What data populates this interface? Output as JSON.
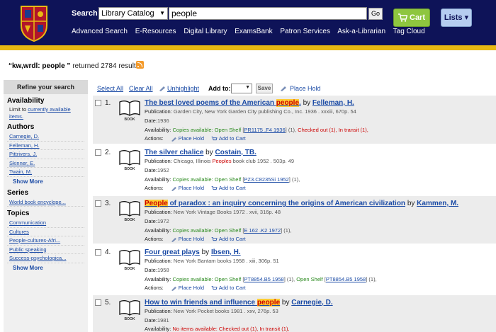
{
  "header": {
    "search_label": "Search",
    "scope_value": "Library Catalog",
    "query_value": "people",
    "go_label": "Go",
    "cart_label": "Cart",
    "lists_label": "Lists ▾",
    "nav": [
      "Advanced Search",
      "E-Resources",
      "Digital Library",
      "ExamsBank",
      "Patron Services",
      "Ask-a-Librarian",
      "Tag Cloud"
    ],
    "colors": {
      "header_bg": "#0e1358",
      "gold_bar": "#e8b913",
      "cart_green": "#8ec63f",
      "lists_blue": "#b6cdf0"
    }
  },
  "results_summary": {
    "query": "“kw,wrdl: people ”",
    "text": "returned 2784 results."
  },
  "sidebar": {
    "heading": "Refine your search",
    "availability": {
      "title": "Availability",
      "text_prefix": "Limit to",
      "link": "currently available items."
    },
    "authors": {
      "title": "Authors",
      "items": [
        "Carnegie, D.",
        "Felleman, H.",
        "Pittrivers, J.",
        "Skinner, E.",
        "Twain, M."
      ],
      "show_more": "Show More"
    },
    "series": {
      "title": "Series",
      "items": [
        "World book encyclope..."
      ]
    },
    "topics": {
      "title": "Topics",
      "items": [
        "Communication",
        "Cultures",
        "People-cultures-Afri...",
        "Public speaking",
        "Success-psychologica..."
      ],
      "show_more": "Show More"
    }
  },
  "toolbar": {
    "select_all": "Select All",
    "clear_all": "Clear All",
    "unhighlight": "Unhighlight",
    "add_to": "Add to:",
    "save": "Save",
    "place_hold": "Place Hold"
  },
  "labels": {
    "publication": "Publication:",
    "date": "Date:",
    "availability": "Availability:",
    "actions": "Actions:",
    "place_hold": "Place Hold",
    "add_to_cart": "Add to Cart",
    "book": "BOOK"
  },
  "results": [
    {
      "num": "1.",
      "title_pre": "The best loved poems of the American ",
      "title_hl": "people",
      "title_post": ".",
      "by": "by",
      "author": "Felleman, H.",
      "pub_pre": "Garden City, New York Garden City publishing Co., Inc. 1936 . xxxiii, 670p. 54",
      "date": "1936",
      "avail_label": "Copies available:",
      "avail_shelf": "Open Shelf",
      "call": "PR1175 .F4 1936",
      "avail_rest": " (1), ",
      "avail_red": "Checked out (1), In transit (1),"
    },
    {
      "num": "2.",
      "title": "The silver chalice",
      "by": "by",
      "author": "Costain, TB.",
      "pub_pre": "Chicago, Illinois ",
      "pub_hl": "Peoples",
      "pub_post": " book club 1952 . 503p. 49",
      "date": "1952",
      "avail_label": "Copies available:",
      "avail_shelf": "Open Shelf",
      "call": "PZ3.C8235Si 1952",
      "avail_rest": " (1),"
    },
    {
      "num": "3.",
      "title_hl": "People",
      "title_post": " of paradox : an inquiry concerning the origins of American civilization",
      "by": "by",
      "author": "Kammen, M.",
      "pub_pre": "New York Vintage Books 1972 . xvii, 316p. 48",
      "date": "1972",
      "avail_label": "Copies available:",
      "avail_shelf": "Open Shelf",
      "call": "E 162 .K2 1972",
      "avail_rest": " (1),"
    },
    {
      "num": "4.",
      "title": "Four great plays",
      "by": "by",
      "author": "Ibsen, H.",
      "pub_pre": "New York Bantam books 1958 . xiii, 306p. 51",
      "date": "1958",
      "avail_label": "Copies available:",
      "avail_shelf": "Open Shelf",
      "call": "PT8854.B5 1958",
      "avail_rest": " (1), ",
      "avail_shelf2": "Open Shelf",
      "call2": "PT8854.B5 1958",
      "avail_rest2": " (1),"
    },
    {
      "num": "5.",
      "title_pre": "How to win friends and influence ",
      "title_hl": "people",
      "by": "by",
      "author": "Carnegie, D.",
      "pub_pre": "New York Pocket books 1981 . xxv, 276p. 53",
      "date": "1981",
      "avail_red": "No items available: Checked out (1), In transit (1),"
    }
  ]
}
